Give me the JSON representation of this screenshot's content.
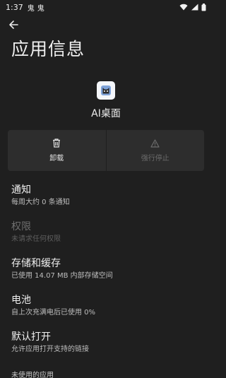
{
  "status_bar": {
    "time": "1:37",
    "notifications": [
      "鬼",
      "鬼"
    ]
  },
  "header": {
    "title": "应用信息"
  },
  "app": {
    "name": "AI桌面"
  },
  "actions": [
    {
      "label": "卸载",
      "icon": "trash-icon",
      "enabled": true
    },
    {
      "label": "强行停止",
      "icon": "warning-icon",
      "enabled": false
    }
  ],
  "items": [
    {
      "title": "通知",
      "subtitle": "每周大约 0 条通知",
      "enabled": true
    },
    {
      "title": "权限",
      "subtitle": "未请求任何权限",
      "enabled": false
    },
    {
      "title": "存储和缓存",
      "subtitle": "已使用 14.07 MB 内部存储空间",
      "enabled": true
    },
    {
      "title": "电池",
      "subtitle": "自上次充满电后已使用 0%",
      "enabled": true
    },
    {
      "title": "默认打开",
      "subtitle": "允许应用打开支持的链接",
      "enabled": true
    }
  ],
  "section_header": "未使用的应用",
  "colors": {
    "background": "#1f1f1f",
    "button_bg": "#2d2d2d",
    "disabled_text": "#6e6e6e"
  }
}
